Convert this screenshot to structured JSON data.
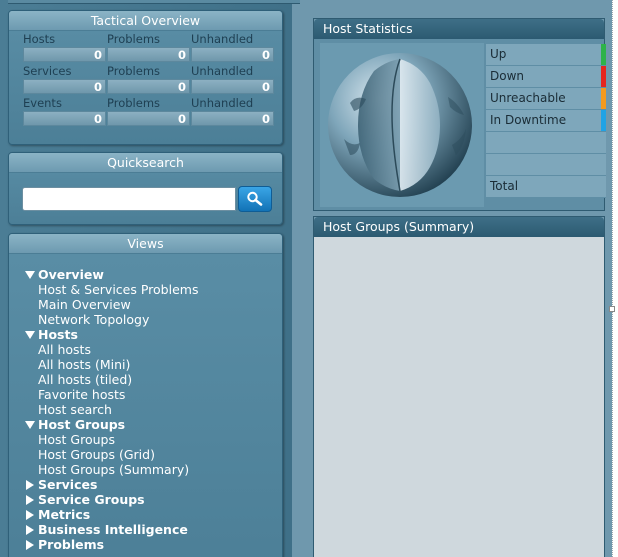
{
  "tactical": {
    "title": "Tactical Overview",
    "rows": [
      {
        "label": "Hosts",
        "problems_label": "Problems",
        "unhandled_label": "Unhandled",
        "total": "0",
        "problems": "0",
        "unhandled": "0"
      },
      {
        "label": "Services",
        "problems_label": "Problems",
        "unhandled_label": "Unhandled",
        "total": "0",
        "problems": "0",
        "unhandled": "0"
      },
      {
        "label": "Events",
        "problems_label": "Problems",
        "unhandled_label": "Unhandled",
        "total": "0",
        "problems": "0",
        "unhandled": "0"
      }
    ]
  },
  "quicksearch": {
    "title": "Quicksearch",
    "value": "",
    "button_icon": "search-icon"
  },
  "views": {
    "title": "Views",
    "sections": [
      {
        "label": "Overview",
        "expanded": true,
        "items": [
          "Host & Services Problems",
          "Main Overview",
          "Network Topology"
        ]
      },
      {
        "label": "Hosts",
        "expanded": true,
        "items": [
          "All hosts",
          "All hosts (Mini)",
          "All hosts (tiled)",
          "Favorite hosts",
          "Host search"
        ]
      },
      {
        "label": "Host Groups",
        "expanded": true,
        "items": [
          "Host Groups",
          "Host Groups (Grid)",
          "Host Groups (Summary)"
        ]
      },
      {
        "label": "Services",
        "expanded": false,
        "items": []
      },
      {
        "label": "Service Groups",
        "expanded": false,
        "items": []
      },
      {
        "label": "Metrics",
        "expanded": false,
        "items": []
      },
      {
        "label": "Business Intelligence",
        "expanded": false,
        "items": []
      },
      {
        "label": "Problems",
        "expanded": false,
        "items": []
      }
    ]
  },
  "host_statistics": {
    "title": "Host Statistics",
    "rows": [
      {
        "label": "Up",
        "color": "#2db34a"
      },
      {
        "label": "Down",
        "color": "#e5251e"
      },
      {
        "label": "Unreachable",
        "color": "#f49a1f"
      },
      {
        "label": "In Downtime",
        "color": "#1fa3e6"
      }
    ],
    "total_label": "Total"
  },
  "host_groups": {
    "title": "Host Groups (Summary)"
  }
}
